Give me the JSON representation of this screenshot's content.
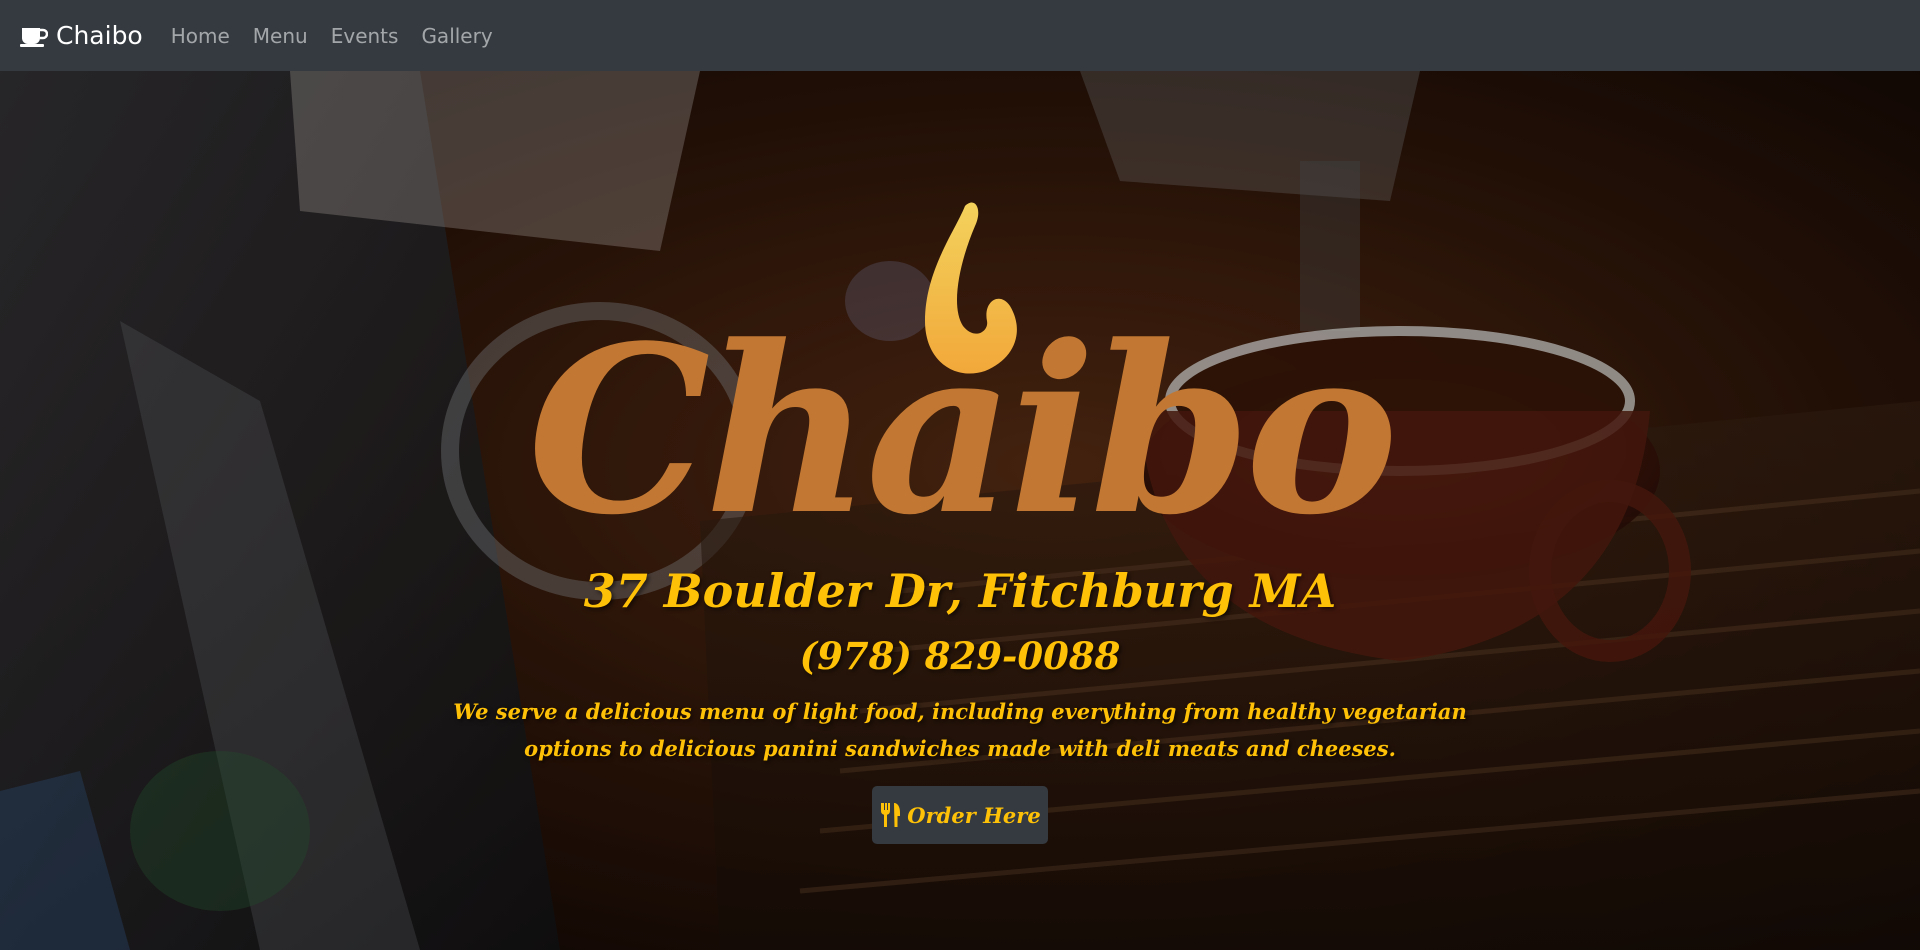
{
  "navbar": {
    "brand": "Chaibo",
    "brand_icon": "coffee-cup-icon",
    "links": [
      "Home",
      "Menu",
      "Events",
      "Gallery"
    ]
  },
  "hero": {
    "logo_text": "Chaibo",
    "address": "37 Boulder Dr, Fitchburg MA",
    "phone": "(978) 829-0088",
    "description": "We serve a delicious menu of light food, including everything from healthy vegetarian options to delicious panini sandwiches made with deli meats and cheeses.",
    "order_button": "Order Here",
    "order_icon": "utensils-icon"
  },
  "colors": {
    "navbar_bg": "#343a40",
    "accent_yellow": "#ffc107",
    "logo_orange": "#c27832",
    "flame_yellow": "#f5c242"
  }
}
